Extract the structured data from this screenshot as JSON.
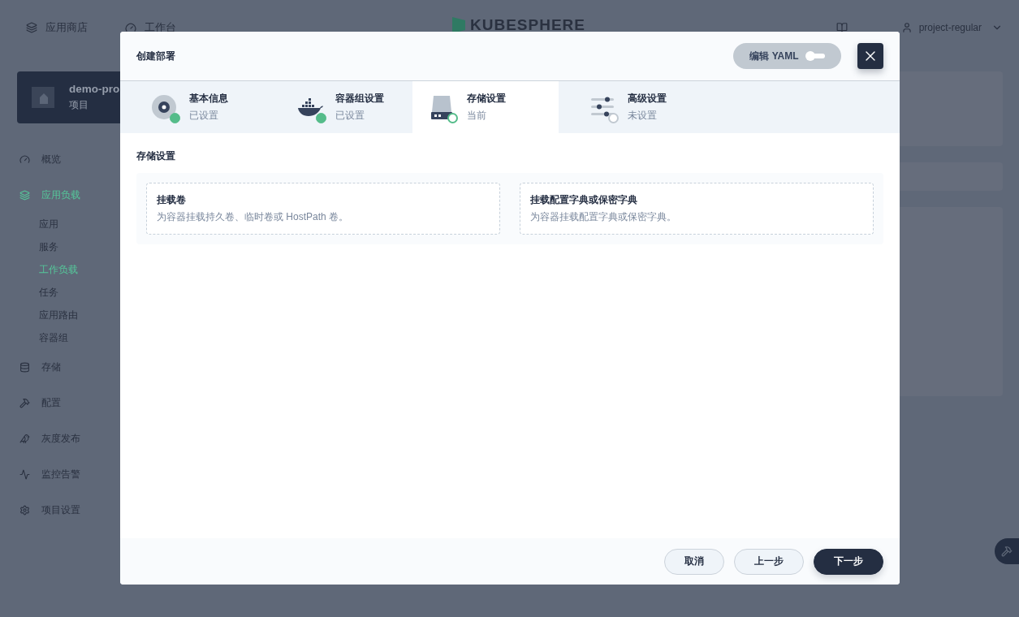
{
  "top_nav": {
    "items": [
      {
        "label": "应用商店"
      },
      {
        "label": "工作台"
      }
    ],
    "logo": "KUBESPHERE",
    "user": "project-regular"
  },
  "project": {
    "name": "demo-pro",
    "type": "项目"
  },
  "sidebar": {
    "items": [
      {
        "label": "概览",
        "selected": false
      },
      {
        "label": "应用负载",
        "selected": true,
        "children": [
          {
            "label": "应用",
            "selected": false
          },
          {
            "label": "服务",
            "selected": false
          },
          {
            "label": "工作负载",
            "selected": true
          },
          {
            "label": "任务",
            "selected": false
          },
          {
            "label": "应用路由",
            "selected": false
          },
          {
            "label": "容器组",
            "selected": false
          }
        ]
      },
      {
        "label": "存储",
        "selected": false
      },
      {
        "label": "配置",
        "selected": false
      },
      {
        "label": "灰度发布",
        "selected": false
      },
      {
        "label": "监控告警",
        "selected": false
      },
      {
        "label": "项目设置",
        "selected": false
      }
    ]
  },
  "modal": {
    "title": "创建部署",
    "yaml_toggle": {
      "label": "编辑 YAML",
      "on": false
    },
    "steps": [
      {
        "title": "基本信息",
        "status": "已设置",
        "selected": false,
        "kind": "done"
      },
      {
        "title": "容器组设置",
        "status": "已设置",
        "selected": false,
        "kind": "done"
      },
      {
        "title": "存储设置",
        "status": "当前",
        "selected": true,
        "kind": "current"
      },
      {
        "title": "高级设置",
        "status": "未设置",
        "selected": false,
        "kind": "todo"
      }
    ],
    "section_title": "存储设置",
    "options": [
      {
        "title": "挂载卷",
        "description": "为容器挂载持久卷、临时卷或 HostPath 卷。"
      },
      {
        "title": "挂载配置字典或保密字典",
        "description": "为容器挂载配置字典或保密字典。"
      }
    ],
    "buttons": [
      {
        "label": "取消",
        "kind": "default"
      },
      {
        "label": "上一步",
        "kind": "default"
      },
      {
        "label": "下一步",
        "kind": "primary"
      }
    ]
  }
}
